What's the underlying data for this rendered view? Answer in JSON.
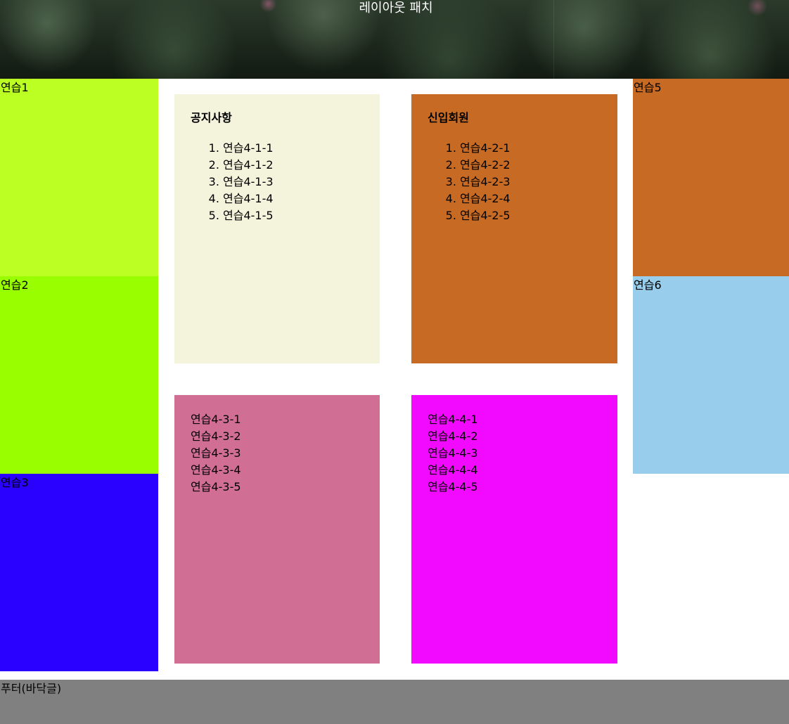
{
  "header": {
    "title": "레이아웃 패치"
  },
  "left_boxes": [
    {
      "label": "연습1",
      "color": "#bbff23"
    },
    {
      "label": "연습2",
      "color": "#99ff00"
    },
    {
      "label": "연습3",
      "color": "#2a00ff"
    }
  ],
  "right_boxes": [
    {
      "label": "연습5",
      "color": "#c66a24"
    },
    {
      "label": "연습6",
      "color": "#98ceeb"
    }
  ],
  "cards": [
    {
      "title": "공지사항",
      "color": "#f4f4dc",
      "items": [
        "연습4-1-1",
        "연습4-1-2",
        "연습4-1-3",
        "연습4-1-4",
        "연습4-1-5"
      ]
    },
    {
      "title": "신입회원",
      "color": "#c66a24",
      "items": [
        "연습4-2-1",
        "연습4-2-2",
        "연습4-2-3",
        "연습4-2-4",
        "연습4-2-5"
      ]
    },
    {
      "color": "#d06e93",
      "items": [
        "연습4-3-1",
        "연습4-3-2",
        "연습4-3-3",
        "연습4-3-4",
        "연습4-3-5"
      ]
    },
    {
      "color": "#f209ff",
      "items": [
        "연습4-4-1",
        "연습4-4-2",
        "연습4-4-3",
        "연습4-4-4",
        "연습4-4-5"
      ]
    }
  ],
  "footer": {
    "label": "푸터(바닥글)",
    "color": "#808080"
  }
}
